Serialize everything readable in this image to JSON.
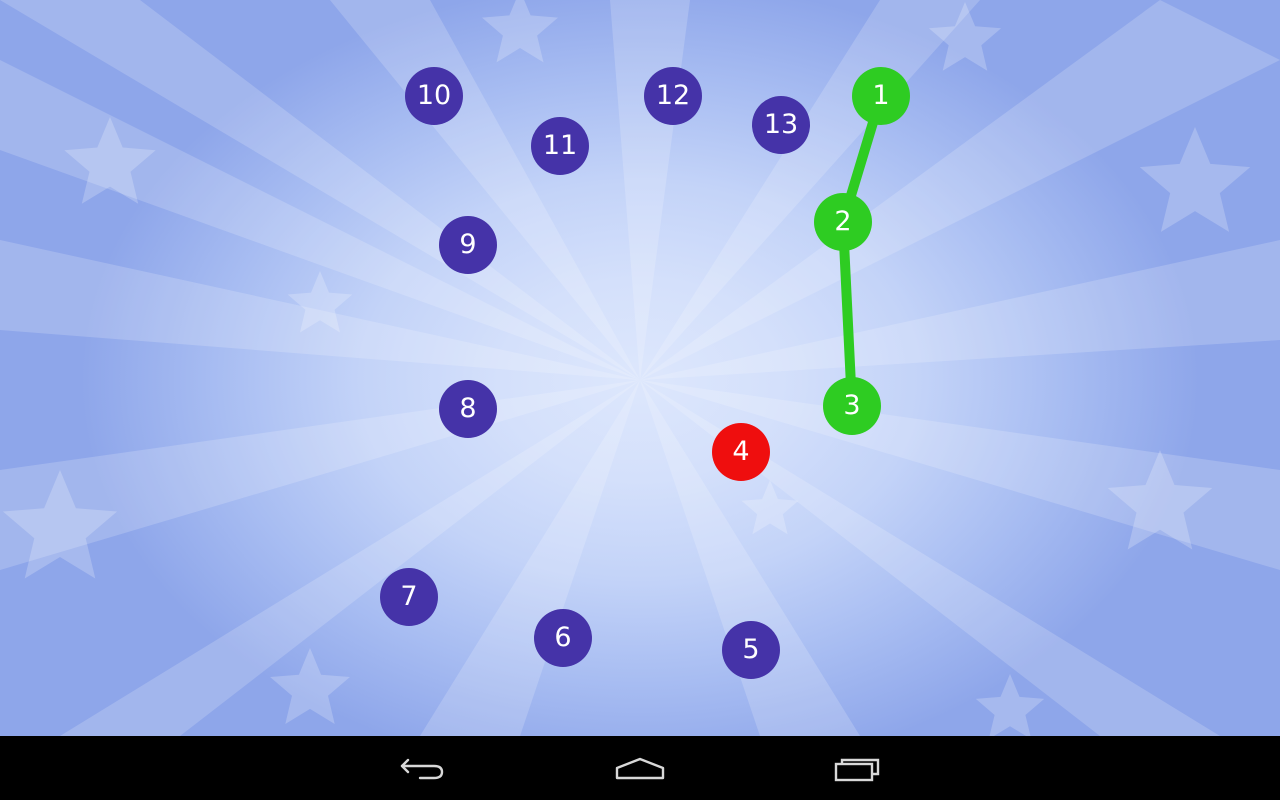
{
  "colors": {
    "dot_pending": "#4533a8",
    "dot_done": "#2ecc22",
    "dot_next": "#ef0e0e",
    "link_line": "#2ecc22",
    "navbar": "#000000",
    "nav_icon": "#d8d8d8"
  },
  "game": {
    "completed_count": 3,
    "next_dot": "4",
    "dots": [
      {
        "label": "1",
        "state": "done"
      },
      {
        "label": "2",
        "state": "done"
      },
      {
        "label": "3",
        "state": "done"
      },
      {
        "label": "4",
        "state": "next"
      },
      {
        "label": "5",
        "state": "pending"
      },
      {
        "label": "6",
        "state": "pending"
      },
      {
        "label": "7",
        "state": "pending"
      },
      {
        "label": "8",
        "state": "pending"
      },
      {
        "label": "9",
        "state": "pending"
      },
      {
        "label": "10",
        "state": "pending"
      },
      {
        "label": "11",
        "state": "pending"
      },
      {
        "label": "12",
        "state": "pending"
      },
      {
        "label": "13",
        "state": "pending"
      }
    ]
  },
  "navbar": {
    "icons": [
      "back-icon",
      "home-icon",
      "recent-apps-icon"
    ]
  }
}
